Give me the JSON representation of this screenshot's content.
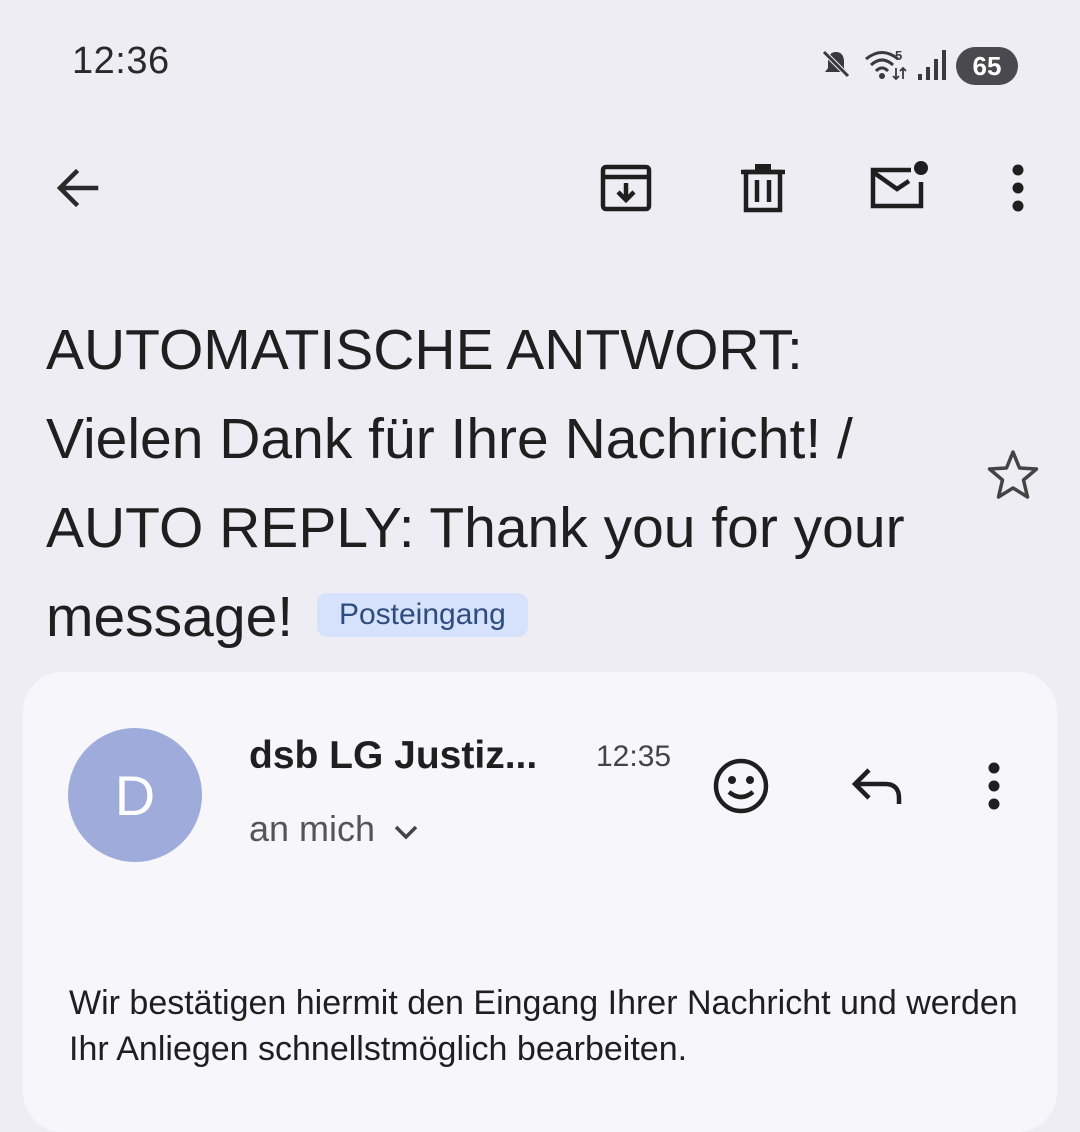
{
  "status_bar": {
    "time": "12:36",
    "battery": "65",
    "icons": [
      "mute-icon",
      "wifi-icon",
      "signal-icon",
      "battery-icon"
    ]
  },
  "toolbar": {
    "icons": [
      "back-arrow-icon",
      "archive-icon",
      "delete-icon",
      "mark-unread-icon",
      "more-vert-icon"
    ]
  },
  "subject": {
    "text": "AUTOMATISCHE ANTWORT: Vielen Dank für Ihre Nachricht! / AUTO REPLY: Thank you for your message!",
    "label": "Posteingang"
  },
  "message": {
    "avatar_letter": "D",
    "sender": "dsb LG Justiz...",
    "time": "12:35",
    "recipient": "an mich",
    "body": "Wir bestätigen hiermit den Eingang Ihrer Nachricht und werden Ihr Anliegen schnellstmöglich bearbeiten."
  },
  "colors": {
    "background": "#eeedf3",
    "card": "#f7f6fb",
    "avatar": "#9fabda",
    "label_chip": "#d6e2fb",
    "label_text": "#2e4c7e"
  }
}
